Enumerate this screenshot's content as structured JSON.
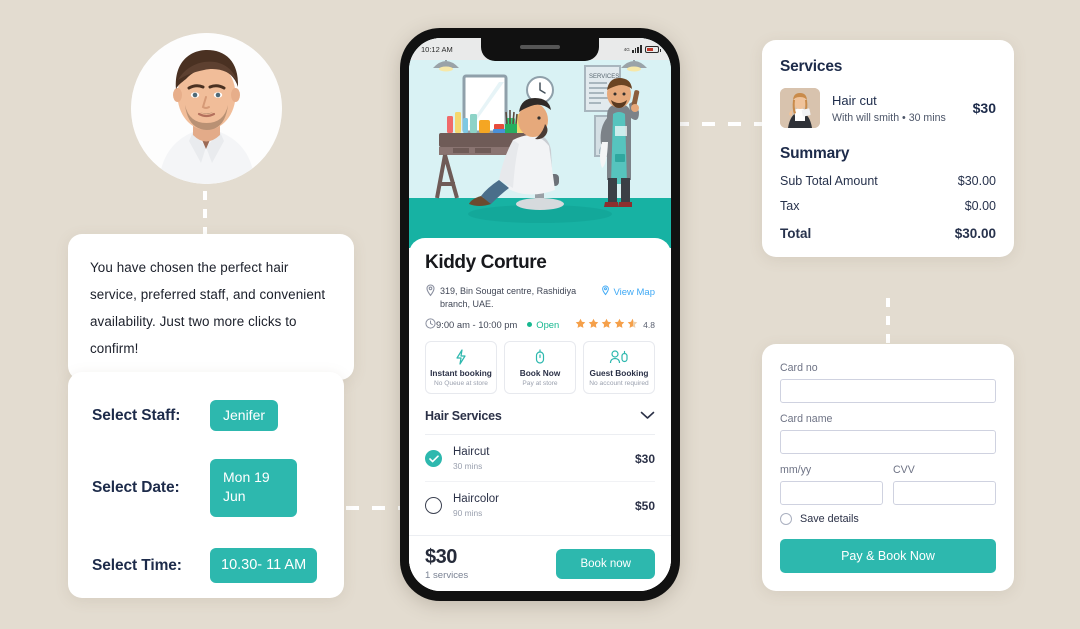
{
  "theme": {
    "background": "#E3DCD0",
    "accent": "#2DB8AE",
    "card": "#FFFFFF",
    "ink": "#1D2B4A",
    "star": "#F5A623",
    "link": "#3FA9F5",
    "open": "#17B890"
  },
  "avatar": {
    "alt": "customer-photo"
  },
  "message": {
    "text": "You have chosen the perfect hair service, preferred staff, and convenient availability. Just two more clicks to confirm!"
  },
  "selectors": {
    "staff": {
      "label": "Select Staff:",
      "value": "Jenifer"
    },
    "date": {
      "label": "Select Date:",
      "value": "Mon 19 Jun"
    },
    "time": {
      "label": "Select Time:",
      "value": "10.30- 11 AM"
    }
  },
  "phone": {
    "status": {
      "time": "10:12 AM",
      "network": "4G"
    },
    "shop": {
      "name": "Kiddy Corture",
      "address": "319, Bin Sougat centre, Rashidiya branch, UAE.",
      "view_map": "View Map",
      "hours": "9:00 am - 10:00 pm",
      "open_label": "Open",
      "rating": "4.8",
      "stars": 4.5
    },
    "booking_options": [
      {
        "icon": "lightning-icon",
        "title": "Instant booking",
        "subtitle": "No Queue at store"
      },
      {
        "icon": "mouse-icon",
        "title": "Book Now",
        "subtitle": "Pay at store"
      },
      {
        "icon": "guest-user-icon",
        "title": "Guest Booking",
        "subtitle": "No account required"
      }
    ],
    "services_section": {
      "title": "Hair Services"
    },
    "services": [
      {
        "name": "Haircut",
        "duration": "30 mins",
        "price": "$30",
        "selected": true
      },
      {
        "name": "Haircolor",
        "duration": "90 mins",
        "price": "$50",
        "selected": false
      }
    ],
    "footer": {
      "total": "$30",
      "count": "1 services",
      "cta": "Book now"
    }
  },
  "summary_card": {
    "services_title": "Services",
    "service": {
      "name": "Hair cut",
      "meta": "With will smith  •  30 mins",
      "price": "$30"
    },
    "summary_title": "Summary",
    "rows": [
      {
        "label": "Sub Total Amount",
        "value": "$30.00"
      },
      {
        "label": "Tax",
        "value": "$0.00"
      }
    ],
    "total": {
      "label": "Total",
      "value": "$30.00"
    }
  },
  "payment_card": {
    "card_no": {
      "label": "Card no",
      "value": ""
    },
    "card_name": {
      "label": "Card name",
      "value": ""
    },
    "expiry": {
      "label": "mm/yy",
      "value": ""
    },
    "cvv": {
      "label": "CVV",
      "value": ""
    },
    "save_details": "Save details",
    "cta": "Pay & Book Now"
  }
}
